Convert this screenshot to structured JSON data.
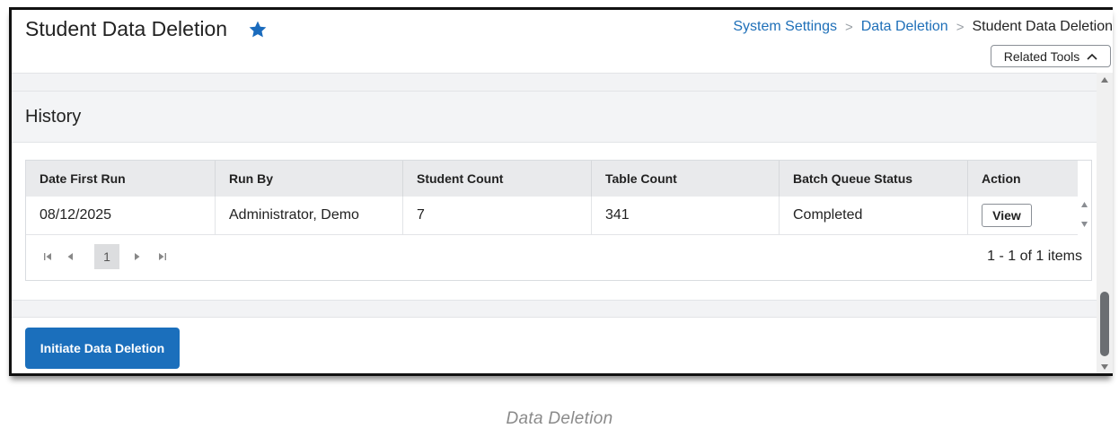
{
  "page": {
    "title": "Student Data Deletion",
    "star_icon": "star-icon",
    "breadcrumb": [
      "System Settings",
      "Data Deletion",
      "Student Data Deletion"
    ],
    "related_tools_label": "Related Tools"
  },
  "history": {
    "title": "History",
    "columns": [
      "Date First Run",
      "Run By",
      "Student Count",
      "Table Count",
      "Batch Queue Status",
      "Action"
    ],
    "rows": [
      {
        "date_first_run": "08/12/2025",
        "run_by": "Administrator, Demo",
        "student_count": "7",
        "table_count": "341",
        "batch_queue_status": "Completed",
        "action": "View"
      }
    ],
    "pager": {
      "current_page": "1",
      "summary": "1 - 1 of 1 items"
    }
  },
  "actions": {
    "initiate_label": "Initiate Data Deletion"
  },
  "caption": "Data Deletion",
  "colors": {
    "accent": "#1b6fbc",
    "link": "#1e6fb8",
    "star": "#1a6bbd"
  }
}
